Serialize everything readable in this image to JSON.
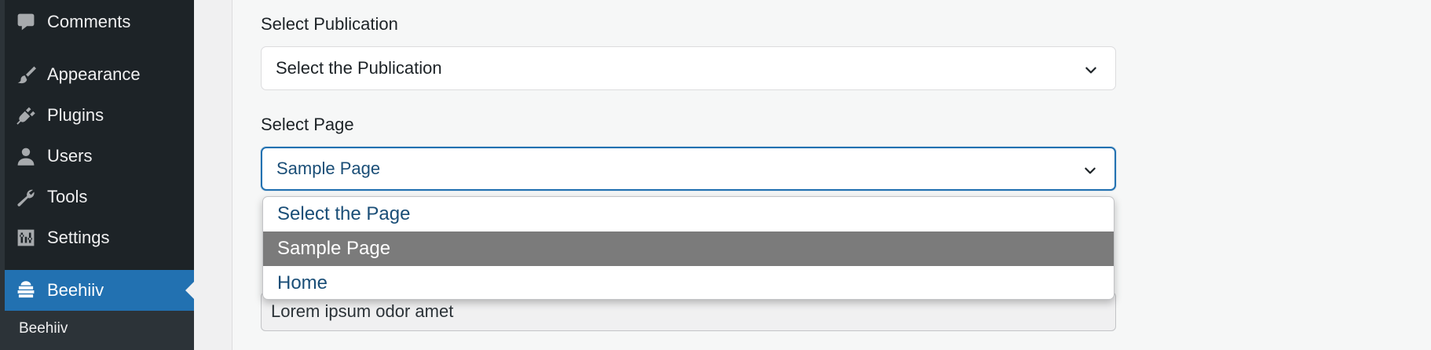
{
  "sidebar": {
    "items": [
      {
        "label": "Comments",
        "icon": "comments-icon"
      },
      {
        "label": "Appearance",
        "icon": "paintbrush-icon"
      },
      {
        "label": "Plugins",
        "icon": "plugin-icon"
      },
      {
        "label": "Users",
        "icon": "user-icon"
      },
      {
        "label": "Tools",
        "icon": "wrench-icon"
      },
      {
        "label": "Settings",
        "icon": "settings-sliders-icon"
      },
      {
        "label": "Beehiiv",
        "icon": "beehive-icon",
        "active": true
      }
    ],
    "submenu": {
      "label": "Beehiiv"
    }
  },
  "form": {
    "publication": {
      "label": "Select Publication",
      "value": "Select the Publication"
    },
    "page": {
      "label": "Select Page",
      "value": "Sample Page",
      "options": [
        "Select the Page",
        "Sample Page",
        "Home"
      ],
      "selected_index": 1
    },
    "text_field": {
      "value": "Lorem ipsum odor amet"
    }
  },
  "colors": {
    "sidebar_bg": "#1d2327",
    "active_bg": "#2271b1",
    "focus_border": "#2271b1",
    "option_text": "#1a4e77",
    "selected_option_bg": "#7b7b7b"
  }
}
